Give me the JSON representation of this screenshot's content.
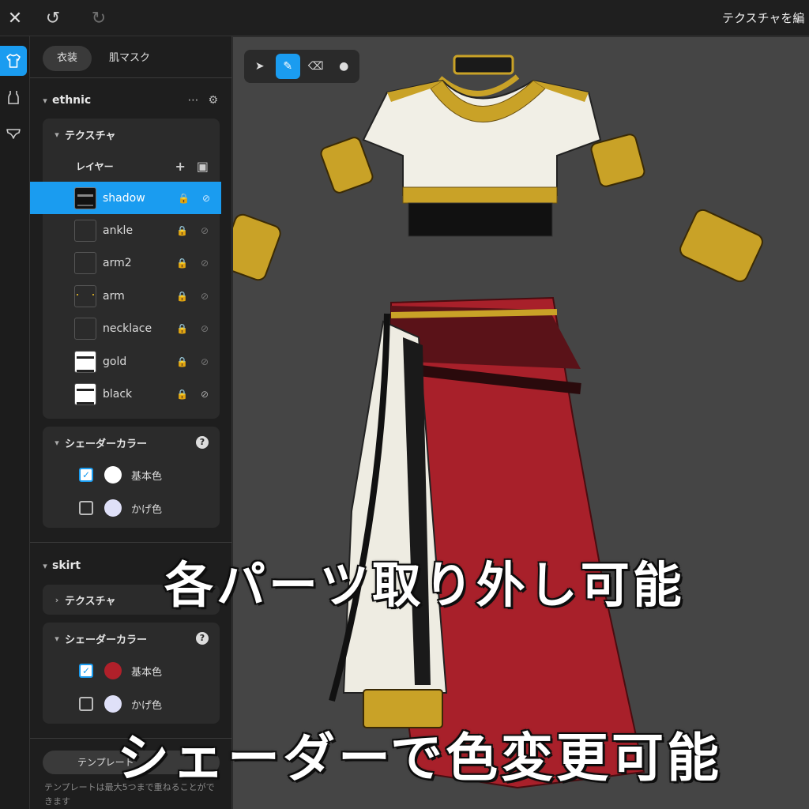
{
  "topbar": {
    "close_icon": "close-icon",
    "undo_icon": "undo-icon",
    "redo_icon": "redo-icon",
    "title": "テクスチャを編"
  },
  "rail": {
    "items": [
      {
        "icon": "shirt-icon",
        "active": true
      },
      {
        "icon": "tank-top-icon",
        "active": false
      },
      {
        "icon": "underwear-icon",
        "active": false
      }
    ]
  },
  "panel": {
    "tabs": [
      {
        "label": "衣装",
        "active": true
      },
      {
        "label": "肌マスク",
        "active": false
      }
    ],
    "ethnic": {
      "name": "ethnic",
      "texture_title": "テクスチャ",
      "layers_label": "レイヤー",
      "layers": [
        {
          "name": "shadow",
          "selected": true
        },
        {
          "name": "ankle"
        },
        {
          "name": "arm2"
        },
        {
          "name": "arm"
        },
        {
          "name": "necklace"
        },
        {
          "name": "gold"
        },
        {
          "name": "black"
        }
      ],
      "shader_title": "シェーダーカラー",
      "shader_colors": [
        {
          "label": "基本色",
          "checked": true,
          "color": "#ffffff"
        },
        {
          "label": "かげ色",
          "checked": false,
          "color": "#dfe0f8"
        }
      ]
    },
    "skirt": {
      "name": "skirt",
      "texture_title": "テクスチャ",
      "shader_title": "シェーダーカラー",
      "shader_colors": [
        {
          "label": "基本色",
          "checked": true,
          "color": "#b0202a"
        },
        {
          "label": "かげ色",
          "checked": false,
          "color": "#dfe0f8"
        }
      ]
    },
    "template_button": "テンプレート",
    "template_note": "テンプレートは最大5つまで重ねることができます"
  },
  "overlay": {
    "line1": "各パーツ取り外し可能",
    "line2": "シェーダーで色変更可能"
  },
  "colors": {
    "accent": "#1a9cf0",
    "skirt_red": "#a8202a",
    "gold": "#c9a227"
  }
}
